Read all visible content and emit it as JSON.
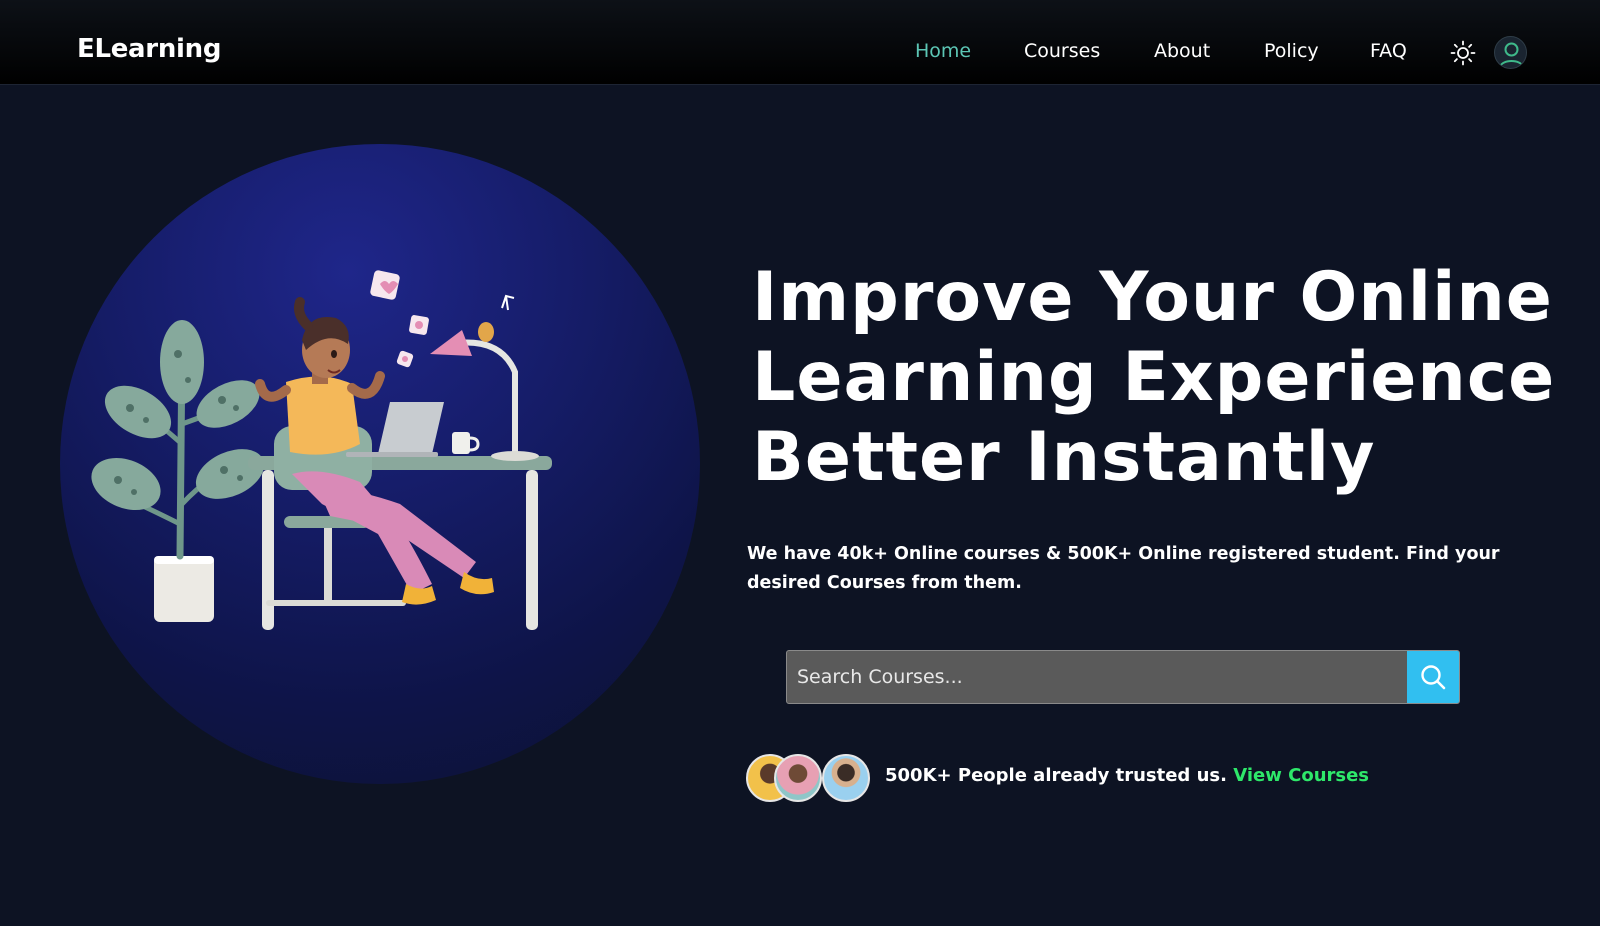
{
  "nav": {
    "brand": "ELearning",
    "links": [
      {
        "label": "Home",
        "active": true
      },
      {
        "label": "Courses",
        "active": false
      },
      {
        "label": "About",
        "active": false
      },
      {
        "label": "Policy",
        "active": false
      },
      {
        "label": "FAQ",
        "active": false
      }
    ],
    "theme_icon": "sun-icon",
    "profile_icon": "user-icon"
  },
  "hero": {
    "title_lines": [
      "Improve Your Online",
      "Learning Experience",
      "Better Instantly"
    ],
    "subtitle": "We have 40k+ Online courses & 500K+ Online registered student. Find your desired Courses from them.",
    "illustration": "woman-at-desk-with-laptop-illustration"
  },
  "search": {
    "placeholder": "Search Courses...",
    "button_icon": "search-icon"
  },
  "trust": {
    "text": "500K+ People already trusted us.",
    "link_label": "View Courses"
  },
  "colors": {
    "background": "#0d1323",
    "accent_nav": "#5cc6b5",
    "search_button": "#31bff0",
    "link_green": "#2ee86a"
  }
}
